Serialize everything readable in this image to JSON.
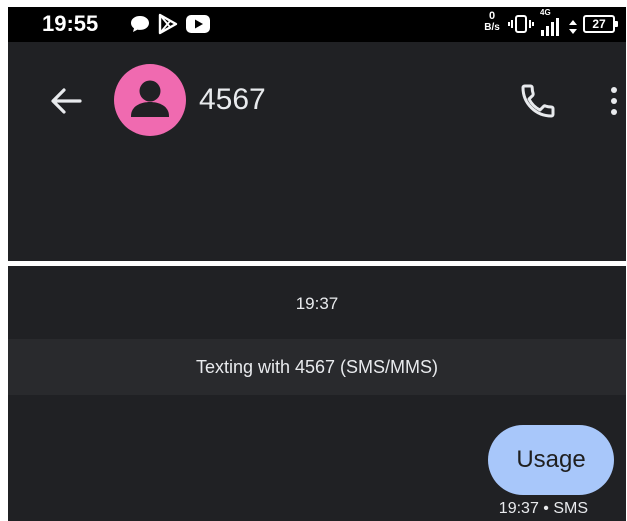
{
  "status_bar": {
    "time": "19:55",
    "net_speed_value": "0",
    "net_speed_unit": "B/s",
    "network_type": "4G",
    "battery_level": "27",
    "icons": [
      "chat-bubble-icon",
      "play-store-icon",
      "youtube-icon",
      "vibrate-icon",
      "signal-icon",
      "data-arrows-icon",
      "battery-icon"
    ]
  },
  "app_bar": {
    "contact_name": "4567",
    "avatar_color": "#f06ab0",
    "icons": [
      "back-arrow-icon",
      "person-icon",
      "phone-icon",
      "more-vert-icon"
    ]
  },
  "conversation": {
    "date_label": "19:37",
    "info_text": "Texting with 4567 (SMS/MMS)",
    "messages": [
      {
        "text": "Usage",
        "meta": "19:37 • SMS",
        "bubble_color": "#a8c7fa"
      }
    ]
  },
  "colors": {
    "background": "#202124",
    "status_bar": "#000000",
    "info_band": "#292a2d",
    "text": "#e8eaed"
  }
}
